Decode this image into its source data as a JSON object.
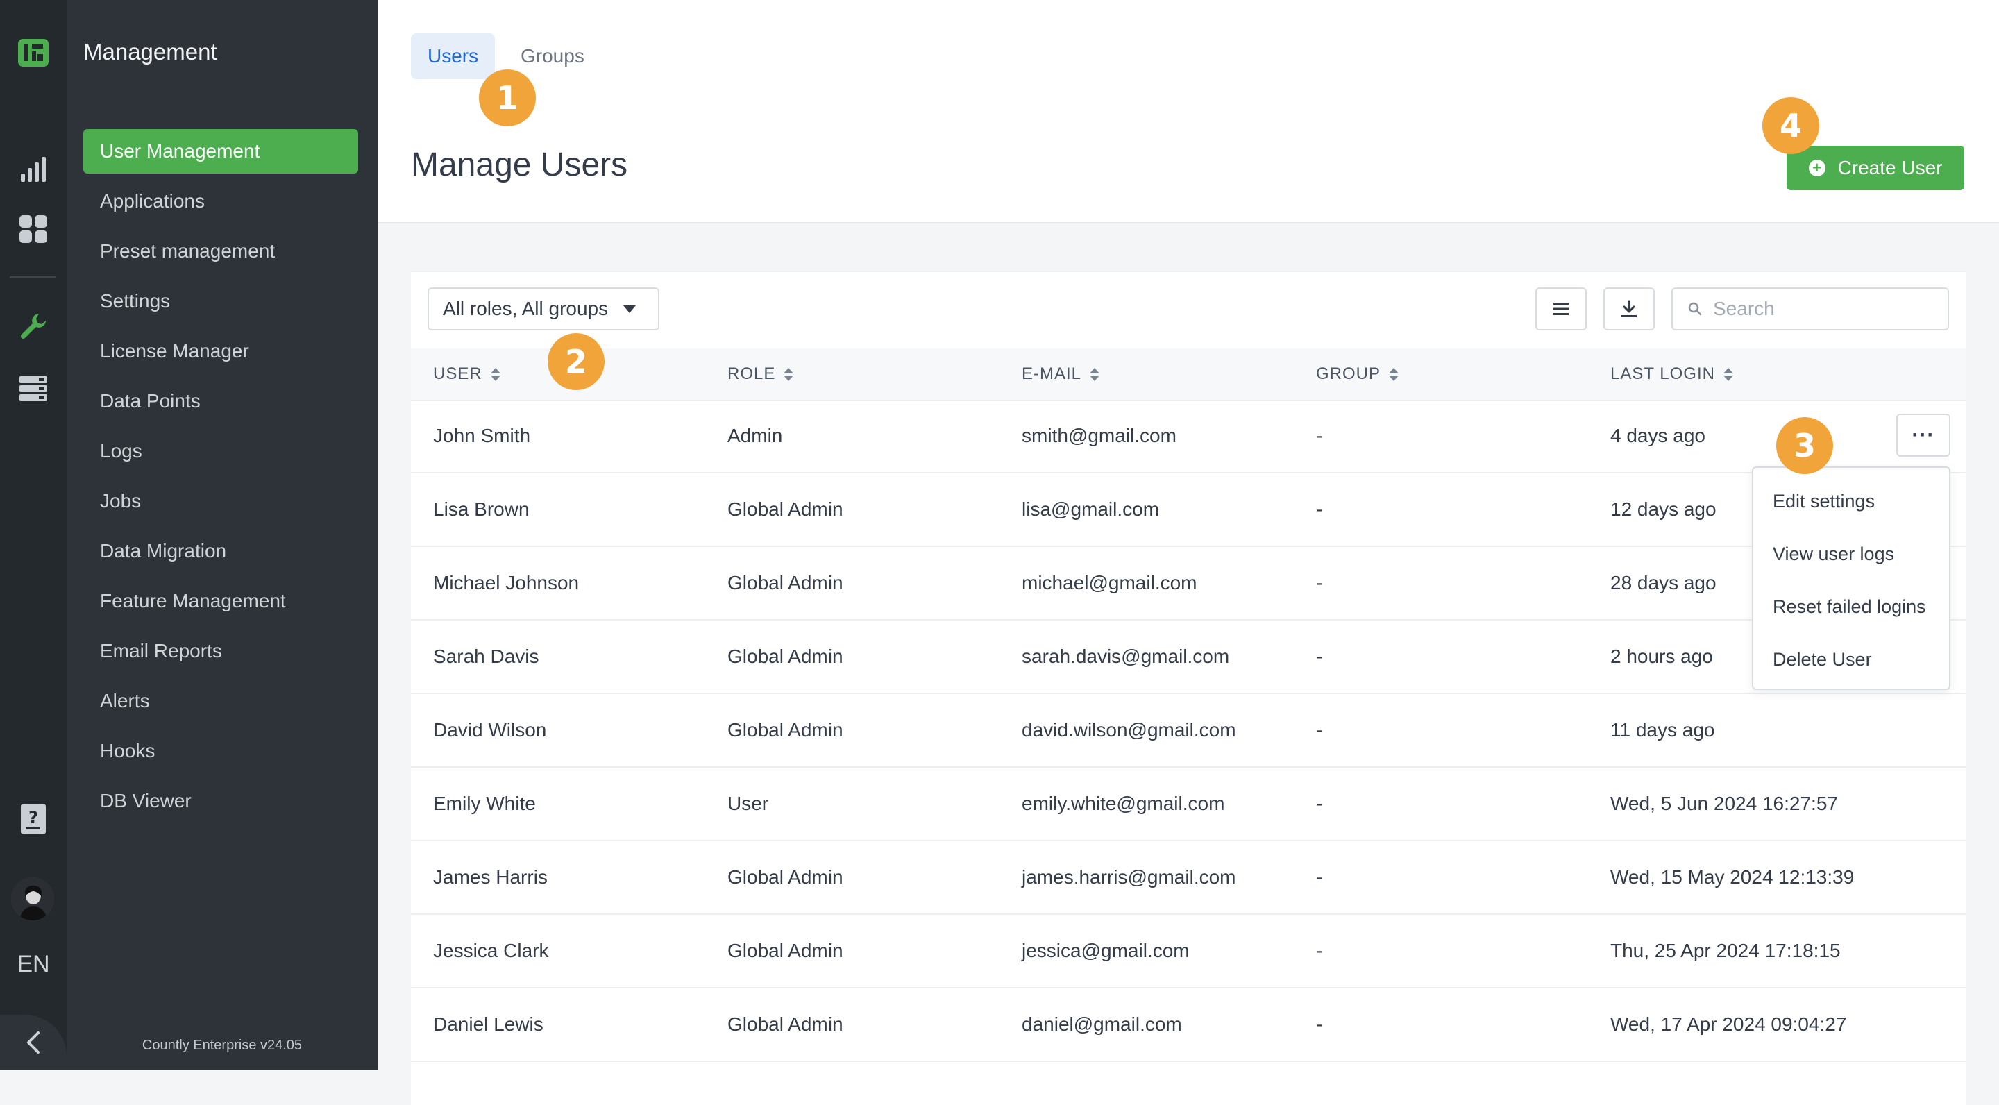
{
  "sidebar": {
    "title": "Management",
    "items": [
      {
        "label": "User Management",
        "active": true
      },
      {
        "label": "Applications"
      },
      {
        "label": "Preset management"
      },
      {
        "label": "Settings"
      },
      {
        "label": "License Manager"
      },
      {
        "label": "Data Points"
      },
      {
        "label": "Logs"
      },
      {
        "label": "Jobs"
      },
      {
        "label": "Data Migration"
      },
      {
        "label": "Feature Management"
      },
      {
        "label": "Email Reports"
      },
      {
        "label": "Alerts"
      },
      {
        "label": "Hooks"
      },
      {
        "label": "DB Viewer"
      }
    ],
    "version": "Countly Enterprise v24.05",
    "language": "EN"
  },
  "header": {
    "tabs": [
      {
        "label": "Users",
        "active": true
      },
      {
        "label": "Groups"
      }
    ],
    "title": "Manage Users",
    "create_button": "Create User"
  },
  "toolbar": {
    "filter": "All roles, All groups",
    "search_placeholder": "Search"
  },
  "table": {
    "columns": [
      "USER",
      "ROLE",
      "E-MAIL",
      "GROUP",
      "LAST LOGIN"
    ],
    "rows": [
      {
        "user": "John Smith",
        "role": "Admin",
        "email": "smith@gmail.com",
        "group": "-",
        "last_login": "4 days ago"
      },
      {
        "user": "Lisa Brown",
        "role": "Global Admin",
        "email": "lisa@gmail.com",
        "group": "-",
        "last_login": "12 days ago"
      },
      {
        "user": "Michael Johnson",
        "role": "Global Admin",
        "email": "michael@gmail.com",
        "group": "-",
        "last_login": "28 days ago"
      },
      {
        "user": "Sarah Davis",
        "role": "Global Admin",
        "email": "sarah.davis@gmail.com",
        "group": "-",
        "last_login": "2 hours ago"
      },
      {
        "user": "David Wilson",
        "role": "Global Admin",
        "email": "david.wilson@gmail.com",
        "group": "-",
        "last_login": "11 days ago"
      },
      {
        "user": "Emily White",
        "role": "User",
        "email": "emily.white@gmail.com",
        "group": "-",
        "last_login": "Wed, 5 Jun 2024 16:27:57"
      },
      {
        "user": "James Harris",
        "role": "Global Admin",
        "email": "james.harris@gmail.com",
        "group": "-",
        "last_login": "Wed, 15 May 2024 12:13:39"
      },
      {
        "user": "Jessica Clark",
        "role": "Global Admin",
        "email": "jessica@gmail.com",
        "group": "-",
        "last_login": "Thu, 25 Apr 2024 17:18:15"
      },
      {
        "user": "Daniel Lewis",
        "role": "Global Admin",
        "email": "daniel@gmail.com",
        "group": "-",
        "last_login": "Wed, 17 Apr 2024 09:04:27"
      }
    ]
  },
  "row_menu": {
    "items": [
      "Edit settings",
      "View user logs",
      "Reset failed logins",
      "Delete User"
    ]
  },
  "callouts": [
    "1",
    "2",
    "3",
    "4"
  ],
  "colors": {
    "accent_green": "#4cae4f",
    "callout_orange": "#f0a43a",
    "tab_active_blue": "#1f6ad3",
    "sidebar_dark": "#2d3339"
  },
  "icons": {
    "rail": [
      "countly-logo-icon",
      "analytics-bar-chart-icon",
      "dashboards-grid-icon",
      "management-wrench-icon",
      "data-manager-icon",
      "help-document-icon",
      "user-avatar",
      "collapse-chevron-left-icon"
    ],
    "toolbar": [
      "list-menu-icon",
      "download-icon",
      "search-icon"
    ]
  }
}
